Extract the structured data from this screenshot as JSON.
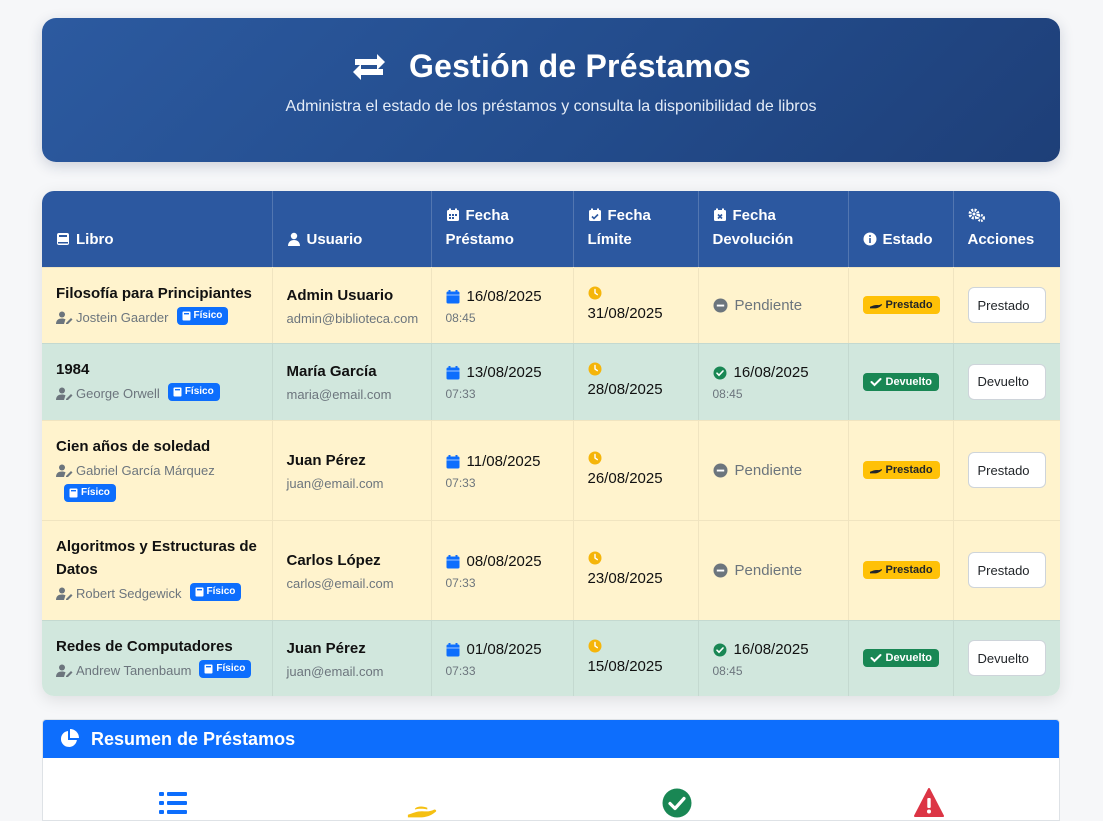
{
  "header": {
    "title": "Gestión de Préstamos",
    "subtitle": "Administra el estado de los préstamos y consulta la disponibilidad de libros",
    "icon": "exchange-icon"
  },
  "table": {
    "columns": [
      {
        "label": "Libro",
        "icon": "book-icon"
      },
      {
        "label": "Usuario",
        "icon": "user-icon"
      },
      {
        "label": "Fecha Préstamo",
        "line1": "Fecha",
        "line2": "Préstamo",
        "icon": "calendar-icon"
      },
      {
        "label": "Fecha Límite",
        "line1": "Fecha",
        "line2": "Límite",
        "icon": "calendar-check-icon"
      },
      {
        "label": "Fecha Devolución",
        "line1": "Fecha",
        "line2": "Devolución",
        "icon": "calendar-x-icon"
      },
      {
        "label": "Estado",
        "icon": "info-icon"
      },
      {
        "label": "Acciones",
        "icon": "cogs-icon"
      }
    ],
    "rows": [
      {
        "title": "Filosofía para Principiantes",
        "author": "Jostein Gaarder",
        "format": "Físico",
        "user": "Admin Usuario",
        "email": "admin@biblioteca.com",
        "loan_date": "16/08/2025",
        "loan_time": "08:45",
        "due_date": "31/08/2025",
        "return_text": "Pendiente",
        "return_date": null,
        "return_time": null,
        "status": "Prestado",
        "action": "Prestado"
      },
      {
        "title": "1984",
        "author": "George Orwell",
        "format": "Físico",
        "user": "María García",
        "email": "maria@email.com",
        "loan_date": "13/08/2025",
        "loan_time": "07:33",
        "due_date": "28/08/2025",
        "return_text": null,
        "return_date": "16/08/2025",
        "return_time": "08:45",
        "status": "Devuelto",
        "action": "Devuelto"
      },
      {
        "title": "Cien años de soledad",
        "author": "Gabriel García Márquez",
        "format": "Físico",
        "user": "Juan Pérez",
        "email": "juan@email.com",
        "loan_date": "11/08/2025",
        "loan_time": "07:33",
        "due_date": "26/08/2025",
        "return_text": "Pendiente",
        "return_date": null,
        "return_time": null,
        "status": "Prestado",
        "action": "Prestado"
      },
      {
        "title": "Algoritmos y Estructuras de Datos",
        "author": "Robert Sedgewick",
        "format": "Físico",
        "user": "Carlos López",
        "email": "carlos@email.com",
        "loan_date": "08/08/2025",
        "loan_time": "07:33",
        "due_date": "23/08/2025",
        "return_text": "Pendiente",
        "return_date": null,
        "return_time": null,
        "status": "Prestado",
        "action": "Prestado"
      },
      {
        "title": "Redes de Computadores",
        "author": "Andrew Tanenbaum",
        "format": "Físico",
        "user": "Juan Pérez",
        "email": "juan@email.com",
        "loan_date": "01/08/2025",
        "loan_time": "07:33",
        "due_date": "15/08/2025",
        "return_text": null,
        "return_date": "16/08/2025",
        "return_time": "08:45",
        "status": "Devuelto",
        "action": "Devuelto"
      }
    ]
  },
  "summary": {
    "title": "Resumen de Préstamos",
    "icon": "pie-chart-icon",
    "stat_icons": [
      "list-icon",
      "hand-holding-icon",
      "check-circle-icon",
      "warning-icon"
    ]
  },
  "colors": {
    "header_bg": "#2c58a0",
    "row_prestado": "#fff3cd",
    "row_devuelto": "#d1e7dd",
    "badge_prestado": "#ffc107",
    "badge_devuelto": "#198754",
    "primary": "#0d6efd"
  }
}
